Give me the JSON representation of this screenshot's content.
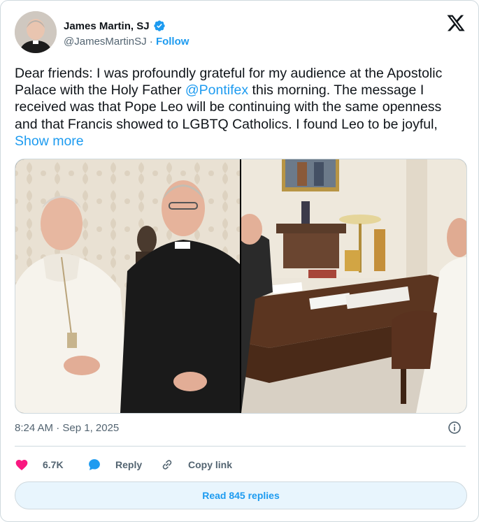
{
  "author": {
    "display_name": "James Martin, SJ",
    "handle": "@JamesMartinSJ",
    "separator": " · ",
    "follow_label": "Follow",
    "verified_color": "#1d9bf0"
  },
  "tweet": {
    "text_before_mention": "Dear friends: I was profoundly grateful for my audience at the Apostolic Palace with the Holy Father ",
    "mention": "@Pontifex",
    "text_after_mention": "  this morning. The message I received was that Pope Leo will be continuing with the same openness and that Francis showed to LGBTQ Catholics. I found Leo to be joyful, ",
    "show_more": "Show more"
  },
  "timestamp": "8:24 AM · Sep 1, 2025",
  "actions": {
    "like_count": "6.7K",
    "reply_label": "Reply",
    "copy_link_label": "Copy link"
  },
  "read_replies_label": "Read 845 replies",
  "colors": {
    "accent": "#1d9bf0",
    "like": "#f91880",
    "text": "#0f1419",
    "muted": "#536471"
  }
}
